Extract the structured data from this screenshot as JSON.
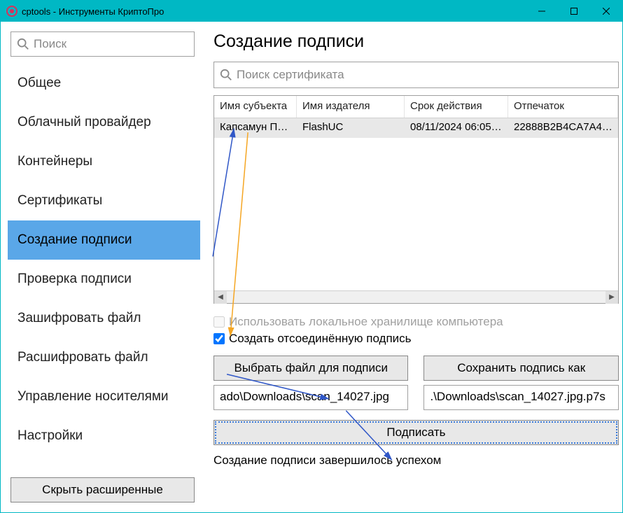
{
  "titlebar": {
    "text": "cptools - Инструменты КриптоПро"
  },
  "sidebar": {
    "search_placeholder": "Поиск",
    "items": [
      "Общее",
      "Облачный провайдер",
      "Контейнеры",
      "Сертификаты",
      "Создание подписи",
      "Проверка подписи",
      "Зашифровать файл",
      "Расшифровать файл",
      "Управление носителями",
      "Настройки"
    ],
    "active_index": 4,
    "hide_advanced": "Скрыть расширенные"
  },
  "main": {
    "title": "Создание подписи",
    "cert_search_placeholder": "Поиск сертификата",
    "table": {
      "headers": [
        "Имя субъекта",
        "Имя издателя",
        "Срок действия",
        "Отпечаток"
      ],
      "rows": [
        {
          "subject": "Капсамун Пр…",
          "issuer": "FlashUC",
          "expiry": "08/11/2024 06:05:…",
          "thumb": "22888B2B4CA7A4…"
        }
      ]
    },
    "checkbox_local": "Использовать локальное хранилище компьютера",
    "checkbox_detached": "Создать отсоединённую подпись",
    "btn_choose_file": "Выбрать файл для подписи",
    "btn_save_as": "Сохранить подпись как",
    "path_in": "ado\\Downloads\\scan_14027.jpg",
    "path_out": ".\\Downloads\\scan_14027.jpg.p7s",
    "btn_sign": "Подписать",
    "status": "Создание подписи завершилось успехом"
  }
}
